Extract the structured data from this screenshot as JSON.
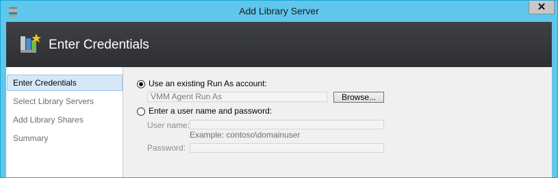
{
  "window": {
    "title": "Add Library Server",
    "close_glyph": "✕"
  },
  "header": {
    "title": "Enter Credentials",
    "icon": "library-server-icon"
  },
  "nav": {
    "items": [
      {
        "label": "Enter Credentials",
        "active": true
      },
      {
        "label": "Select Library Servers",
        "active": false
      },
      {
        "label": "Add Library Shares",
        "active": false
      },
      {
        "label": "Summary",
        "active": false
      }
    ]
  },
  "form": {
    "option_existing": {
      "label": "Use an existing Run As account:",
      "selected": true
    },
    "runas_value": "VMM Agent Run As",
    "browse_label": "Browse...",
    "option_manual": {
      "label": "Enter a user name and password:",
      "selected": false
    },
    "username": {
      "label": "User name:",
      "value": "",
      "hint": "Example: contoso\\domainuser"
    },
    "password": {
      "label": "Password:",
      "value": ""
    }
  },
  "colors": {
    "titlebar": "#5fc7ec",
    "header": "#38393d",
    "nav_active": "#d6e8f8"
  }
}
